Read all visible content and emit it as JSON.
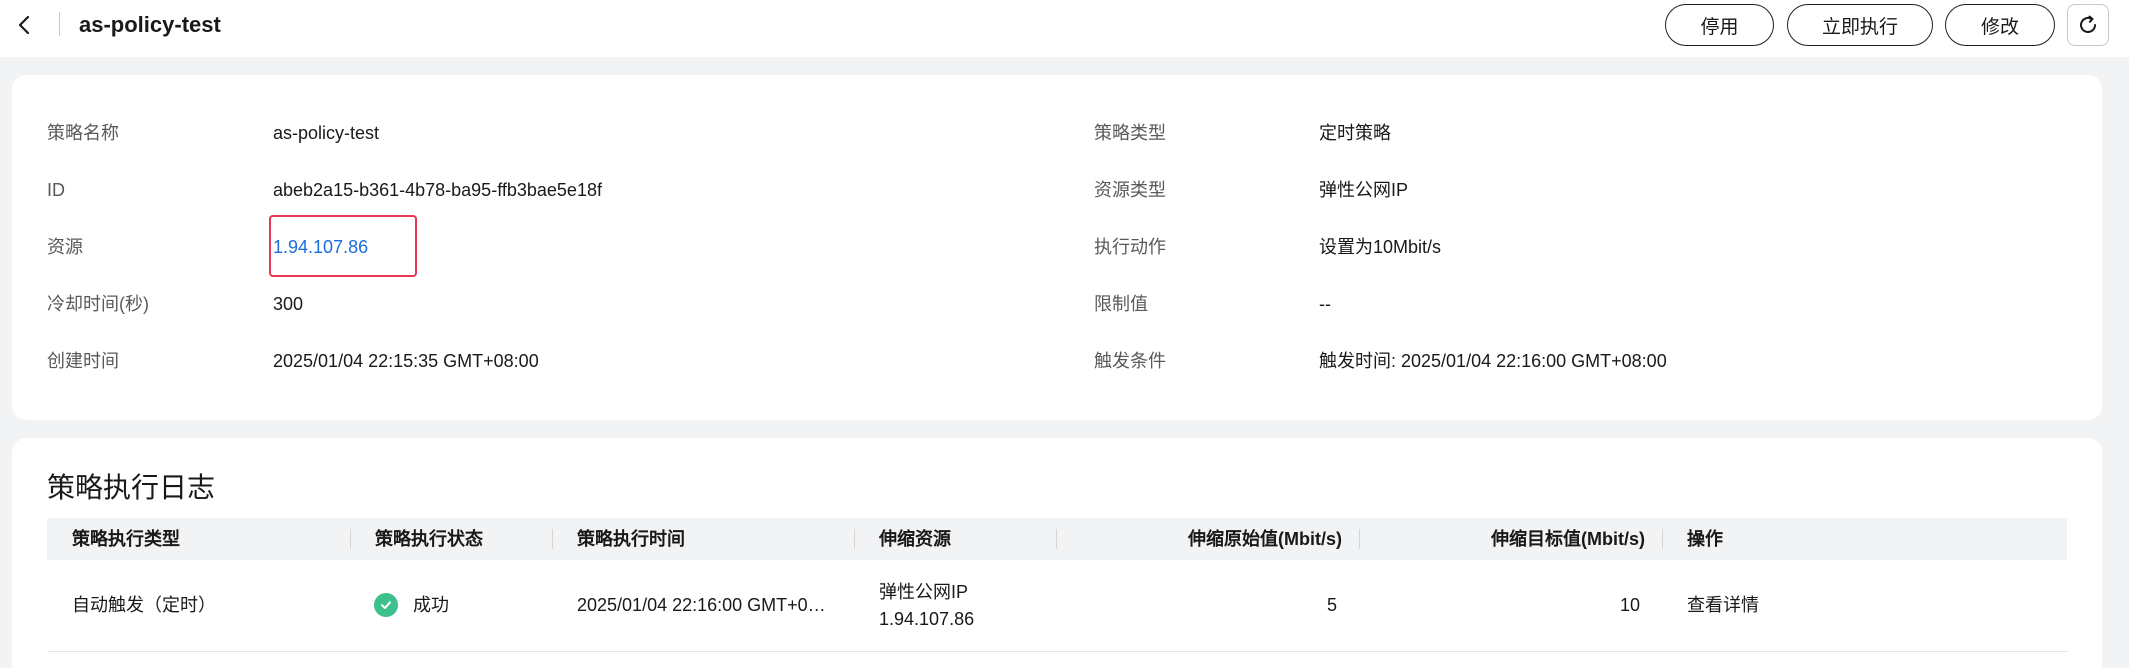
{
  "header": {
    "title": "as-policy-test",
    "buttons": {
      "disable": "停用",
      "execute_now": "立即执行",
      "modify": "修改"
    }
  },
  "details": {
    "left": [
      {
        "label": "策略名称",
        "value": "as-policy-test"
      },
      {
        "label": "ID",
        "value": "abeb2a15-b361-4b78-ba95-ffb3bae5e18f"
      },
      {
        "label": "资源",
        "value": "1.94.107.86"
      },
      {
        "label": "冷却时间(秒)",
        "value": "300"
      },
      {
        "label": "创建时间",
        "value": "2025/01/04 22:15:35 GMT+08:00"
      }
    ],
    "right": [
      {
        "label": "策略类型",
        "value": "定时策略"
      },
      {
        "label": "资源类型",
        "value": "弹性公网IP"
      },
      {
        "label": "执行动作",
        "value": "设置为10Mbit/s"
      },
      {
        "label": "限制值",
        "value": "--"
      },
      {
        "label": "触发条件",
        "value": "触发时间: 2025/01/04 22:16:00 GMT+08:00"
      }
    ]
  },
  "log": {
    "title": "策略执行日志",
    "columns": [
      "策略执行类型",
      "策略执行状态",
      "策略执行时间",
      "伸缩资源",
      "伸缩原始值(Mbit/s)",
      "伸缩目标值(Mbit/s)",
      "操作"
    ],
    "rows": [
      {
        "type": "自动触发（定时）",
        "status": "成功",
        "time": "2025/01/04 22:16:00 GMT+0…",
        "resource_type": "弹性公网IP",
        "resource_ip": "1.94.107.86",
        "original": "5",
        "target": "10",
        "action": "查看详情"
      }
    ]
  },
  "colors": {
    "link": "#1a6edb",
    "success": "#3cc08c",
    "highlight": "#e8384f"
  }
}
